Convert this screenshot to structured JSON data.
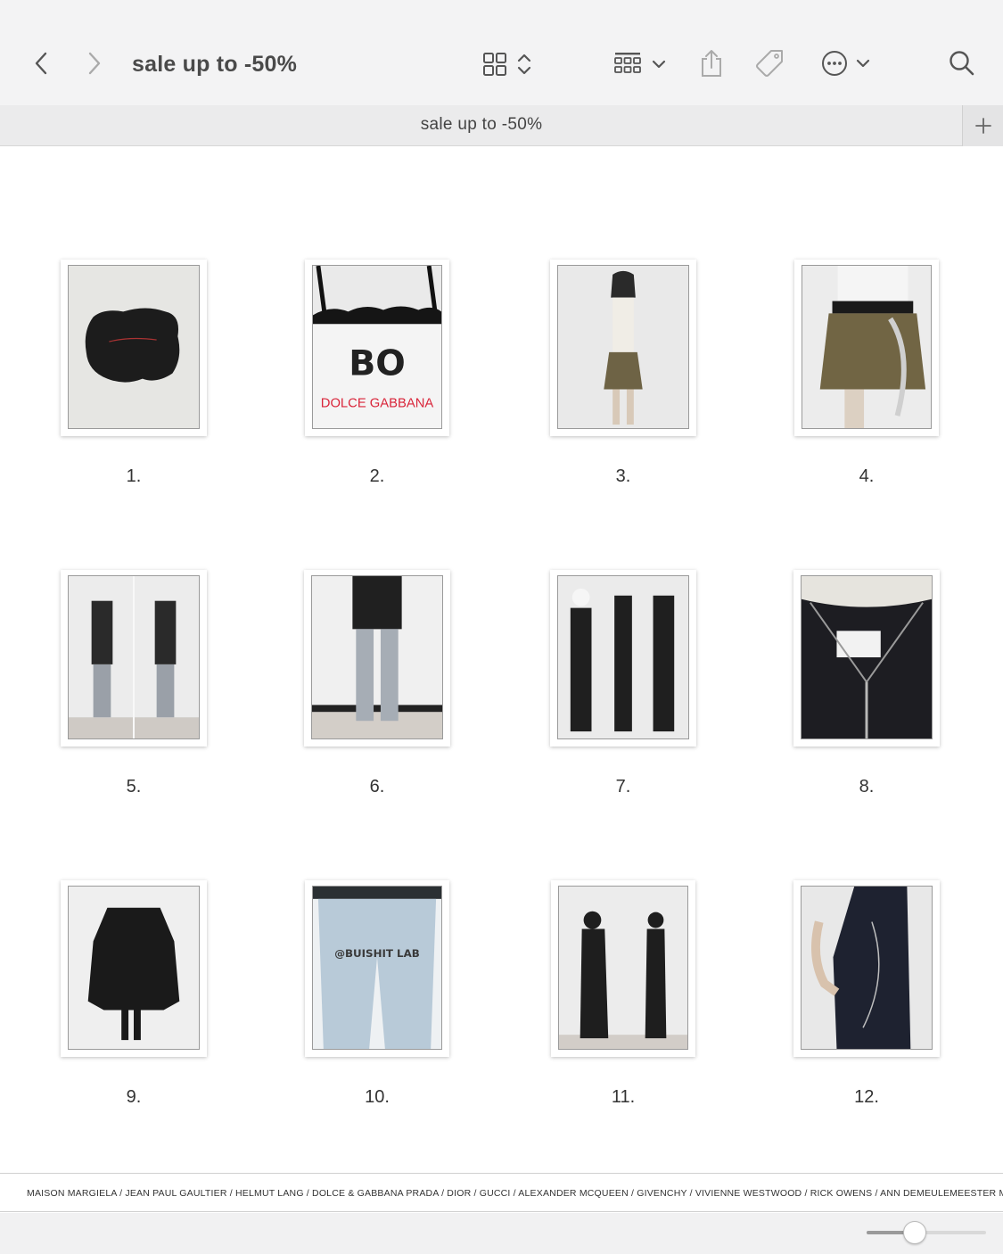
{
  "window": {
    "title": "sale up to -50%"
  },
  "toolbar": {
    "icons": [
      "chevron-left-icon",
      "chevron-right-icon",
      "grid-view-icon",
      "up-down-chevron-icon",
      "group-view-icon",
      "chevron-down-icon",
      "share-icon",
      "tag-icon",
      "more-icon",
      "search-icon"
    ]
  },
  "tab": {
    "title": "sale up to -50%",
    "add_label": "+"
  },
  "items": [
    {
      "caption": "1."
    },
    {
      "caption": "2."
    },
    {
      "caption": "3."
    },
    {
      "caption": "4."
    },
    {
      "caption": "5."
    },
    {
      "caption": "6."
    },
    {
      "caption": "7."
    },
    {
      "caption": "8."
    },
    {
      "caption": "9."
    },
    {
      "caption": "10."
    },
    {
      "caption": "11."
    },
    {
      "caption": "12."
    }
  ],
  "photo_text": {
    "item2_brand": "DOLCE GABBANA",
    "item2_letters": "BO",
    "item10_print": "@BUISHIT LAB"
  },
  "brands": {
    "text": "MAISON MARGIELA / JEAN PAUL GAULTIER / HELMUT LANG / DOLCE & GABBANA PRADA  / DIOR / GUCCI  / ALEXANDER MCQUEEN / GIVENCHY / VIVIENNE WESTWOOD / RICK OWENS  / ANN DEMEULEMEESTER  MORE ..."
  },
  "zoom": {
    "value": 0.4
  },
  "colors": {
    "toolbar_bg": "#f3f3f4",
    "tabbar_bg": "#ebebec",
    "accent_red": "#d9253a"
  }
}
